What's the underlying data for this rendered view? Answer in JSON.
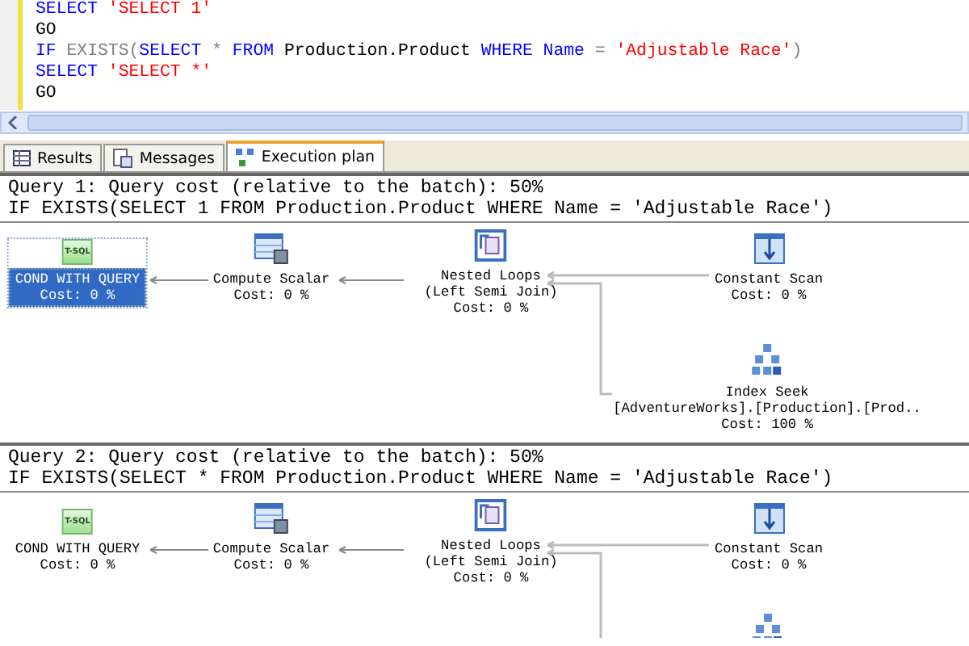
{
  "editor": {
    "lines": [
      [
        {
          "kind": "keyword",
          "text": "SELECT "
        },
        {
          "kind": "string",
          "text": "'SELECT 1'"
        }
      ],
      [
        {
          "kind": "plain",
          "text": "GO"
        }
      ],
      [
        {
          "kind": "keyword",
          "text": "IF "
        },
        {
          "kind": "operator",
          "text": "EXISTS("
        },
        {
          "kind": "keyword",
          "text": "SELECT "
        },
        {
          "kind": "operator",
          "text": "* "
        },
        {
          "kind": "keyword",
          "text": "FROM "
        },
        {
          "kind": "plain",
          "text": "Production.Product "
        },
        {
          "kind": "keyword",
          "text": "WHERE Name "
        },
        {
          "kind": "operator",
          "text": "= "
        },
        {
          "kind": "string",
          "text": "'Adjustable Race'"
        },
        {
          "kind": "operator",
          "text": ")"
        }
      ],
      [
        {
          "kind": "keyword",
          "text": "SELECT "
        },
        {
          "kind": "string",
          "text": "'SELECT *'"
        }
      ],
      [
        {
          "kind": "plain",
          "text": "GO"
        }
      ]
    ]
  },
  "tabs": [
    {
      "label": "Results",
      "kind": "grid",
      "selected": false
    },
    {
      "label": "Messages",
      "kind": "messages",
      "selected": false
    },
    {
      "label": "Execution plan",
      "kind": "plan",
      "selected": true
    }
  ],
  "plans": [
    {
      "header": "Query 1: Query cost (relative to the batch): 50%",
      "statement": "IF EXISTS(SELECT 1 FROM Production.Product WHERE Name = 'Adjustable Race')",
      "nodes": [
        {
          "kind": "tsql",
          "icon_text": "T-SQL",
          "lines": [
            "COND WITH QUERY",
            "Cost: 0 %"
          ],
          "selected": true
        },
        {
          "kind": "compute",
          "lines": [
            "Compute Scalar",
            "Cost: 0 %"
          ],
          "selected": false
        },
        {
          "kind": "loops",
          "lines": [
            "Nested Loops",
            "(Left Semi Join)",
            "Cost: 0 %"
          ],
          "selected": false
        },
        {
          "kind": "constant",
          "lines": [
            "Constant Scan",
            "Cost: 0 %"
          ],
          "selected": false
        },
        {
          "kind": "seek",
          "lines": [
            "Index Seek",
            "[AdventureWorks].[Production].[Prod..",
            "Cost: 100 %"
          ],
          "selected": false
        }
      ]
    },
    {
      "header": "Query 2: Query cost (relative to the batch): 50%",
      "statement": "IF EXISTS(SELECT * FROM Production.Product WHERE Name = 'Adjustable Race')",
      "nodes": [
        {
          "kind": "tsql",
          "icon_text": "T-SQL",
          "lines": [
            "COND WITH QUERY",
            "Cost: 0 %"
          ],
          "selected": false
        },
        {
          "kind": "compute",
          "lines": [
            "Compute Scalar",
            "Cost: 0 %"
          ],
          "selected": false
        },
        {
          "kind": "loops",
          "lines": [
            "Nested Loops",
            "(Left Semi Join)",
            "Cost: 0 %"
          ],
          "selected": false
        },
        {
          "kind": "constant",
          "lines": [
            "Constant Scan",
            "Cost: 0 %"
          ],
          "selected": false
        },
        {
          "kind": "seek",
          "selected": false
        }
      ]
    }
  ]
}
